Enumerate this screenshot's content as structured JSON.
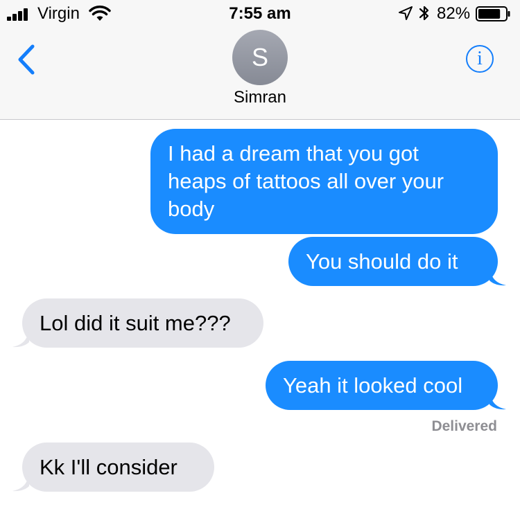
{
  "status_bar": {
    "carrier": "Virgin",
    "time": "7:55 am",
    "battery_percent": "82%",
    "battery_level": 0.82,
    "signal_bars": 4,
    "icons": [
      "signal-icon",
      "wifi-icon",
      "location-arrow-icon",
      "bluetooth-icon",
      "battery-icon"
    ]
  },
  "header": {
    "back_icon": "chevron-left-icon",
    "avatar_initial": "S",
    "contact_name": "Simran",
    "info_icon": "info-icon",
    "info_glyph": "i"
  },
  "messages": [
    {
      "direction": "sent",
      "text": "I had a dream that you got heaps of tattoos all over your body"
    },
    {
      "direction": "sent",
      "text": "You should do it"
    },
    {
      "direction": "received",
      "text": "Lol did it suit me???"
    },
    {
      "direction": "sent",
      "text": "Yeah it looked cool"
    },
    {
      "direction": "received",
      "text": "Kk I'll consider"
    }
  ],
  "delivery_status": "Delivered",
  "colors": {
    "sent_bubble": "#1a8cff",
    "received_bubble": "#e5e5ea",
    "accent": "#147efb",
    "header_bg": "#f7f7f7",
    "status_gray": "#8e8e93"
  }
}
